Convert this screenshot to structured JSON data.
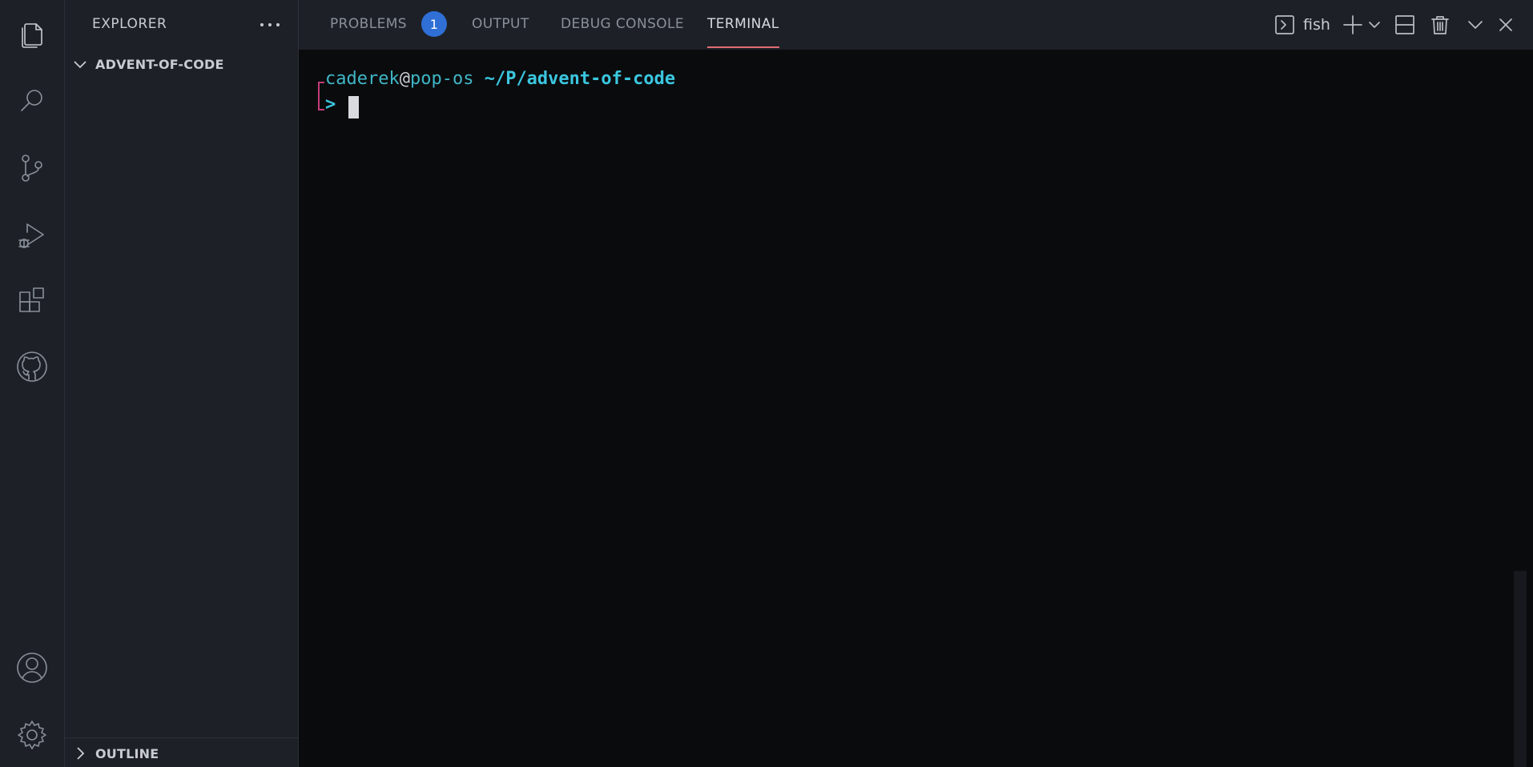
{
  "activity_bar": {
    "items": [
      {
        "name": "explorer",
        "icon": "files-icon"
      },
      {
        "name": "search",
        "icon": "search-icon"
      },
      {
        "name": "source-control",
        "icon": "source-control-icon"
      },
      {
        "name": "run-debug",
        "icon": "run-debug-icon"
      },
      {
        "name": "extensions",
        "icon": "extensions-icon"
      },
      {
        "name": "github",
        "icon": "github-icon"
      }
    ],
    "bottom": [
      {
        "name": "accounts",
        "icon": "account-icon"
      },
      {
        "name": "manage",
        "icon": "gear-icon"
      }
    ]
  },
  "sidebar": {
    "title": "EXPLORER",
    "folder": "ADVENT-OF-CODE",
    "outline": "OUTLINE"
  },
  "panel": {
    "tabs": [
      {
        "label": "PROBLEMS",
        "badge": "1"
      },
      {
        "label": "OUTPUT"
      },
      {
        "label": "DEBUG CONSOLE"
      },
      {
        "label": "TERMINAL",
        "active": true
      }
    ],
    "terminal_name": "fish"
  },
  "terminal": {
    "user": "caderek",
    "at": "@",
    "host": "pop-os",
    "path": "~/P/advent-of-code",
    "prompt": ">"
  },
  "colors": {
    "accent_underline": "#e06c75",
    "badge": "#2f6fd6",
    "prompt_cyan": "#3bc7e0",
    "bracket_magenta": "#c23c78"
  }
}
